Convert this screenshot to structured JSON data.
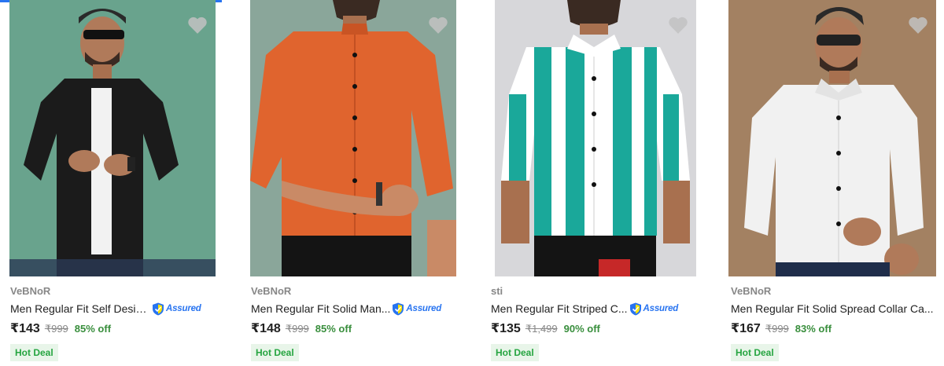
{
  "accent_color": "#2874f0",
  "products": [
    {
      "brand": "VeBNoR",
      "title": "Men Regular Fit Self Design Mandarin Collar Casual Shirt",
      "title_display": "Men Regular Fit Self Desig...",
      "assured": true,
      "assured_label": "Assured",
      "price": "₹143",
      "mrp": "₹999",
      "discount": "85% off",
      "deal": "Hot Deal",
      "shirt_color": "#1b1b1b",
      "bg_color": "#6fa892",
      "icon": "heart-icon"
    },
    {
      "brand": "VeBNoR",
      "title": "Men Regular Fit Solid Mandarin Collar Casual Shirt",
      "title_display": "Men Regular Fit Solid Man...",
      "assured": true,
      "assured_label": "Assured",
      "price": "₹148",
      "mrp": "₹999",
      "discount": "85% off",
      "deal": "Hot Deal",
      "shirt_color": "#e0642e",
      "bg_color": "#8aa69a",
      "icon": "heart-icon"
    },
    {
      "brand": "sti",
      "title": "Men Regular Fit Striped Casual Shirt",
      "title_display": "Men Regular Fit Striped C...",
      "assured": true,
      "assured_label": "Assured",
      "price": "₹135",
      "mrp": "₹1,499",
      "discount": "90% off",
      "deal": "Hot Deal",
      "shirt_color": "#1aa89a",
      "bg_color": "#d7d7da",
      "icon": "heart-icon"
    },
    {
      "brand": "VeBNoR",
      "title": "Men Regular Fit Solid Spread Collar Casual Shirt",
      "title_display": "Men Regular Fit Solid Spread Collar Ca...",
      "assured": false,
      "price": "₹167",
      "mrp": "₹999",
      "discount": "83% off",
      "deal": "Hot Deal",
      "shirt_color": "#f1f1f1",
      "bg_color": "#9c7a5c",
      "icon": "heart-icon"
    }
  ]
}
